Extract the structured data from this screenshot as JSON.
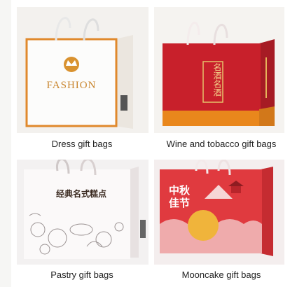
{
  "products": [
    {
      "caption": "Dress gift bags",
      "brand": "FASHION"
    },
    {
      "caption": "Wine and tobacco gift bags",
      "label": "名酒名酒"
    },
    {
      "caption": "Pastry gift bags",
      "label": "经典名式糕点"
    },
    {
      "caption": "Mooncake gift bags",
      "label": "中秋佳节"
    }
  ],
  "colors": {
    "background": "#ffffff",
    "dress_orange": "#e0892c",
    "wine_red": "#c8202b",
    "wine_orange": "#e9871c",
    "mooncake_red": "#e03a3f",
    "mooncake_yellow": "#f0b43b"
  }
}
